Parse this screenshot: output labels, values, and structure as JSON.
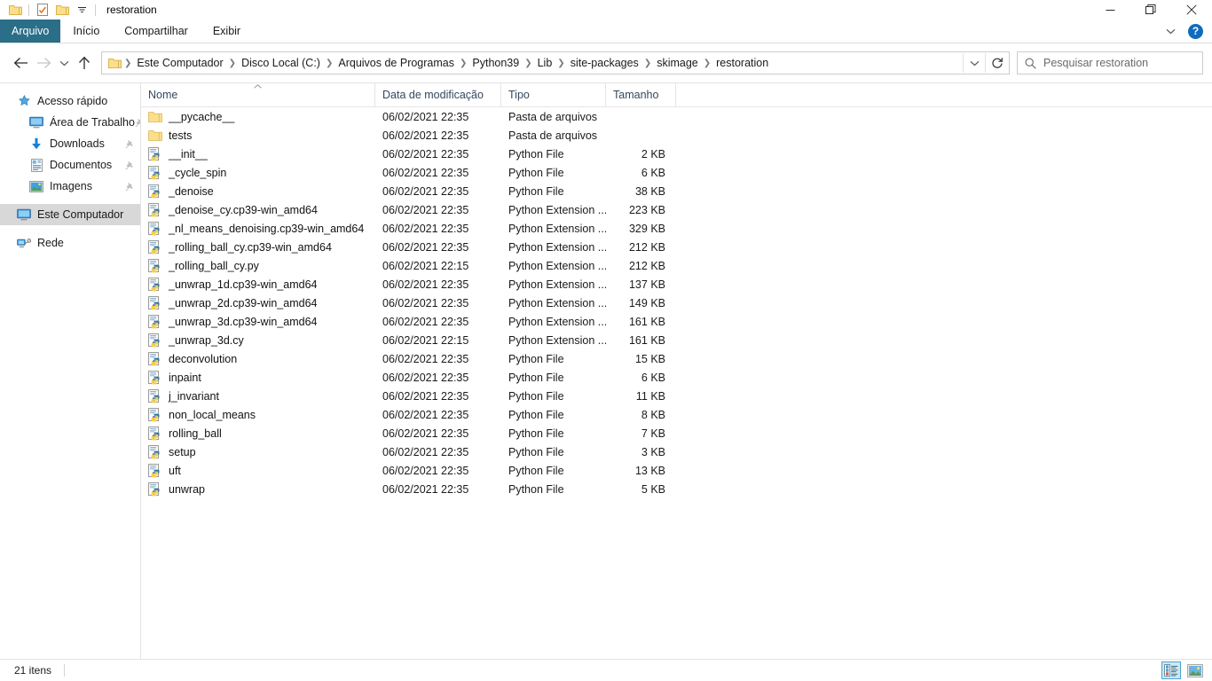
{
  "window": {
    "title": "restoration",
    "quick_access": [
      {
        "name": "folder-icon",
        "label": "Folder"
      },
      {
        "name": "properties-icon",
        "label": "Properties"
      },
      {
        "name": "new-folder-icon",
        "label": "New folder"
      },
      {
        "name": "chevron-down-icon",
        "label": "Customize Quick Access Toolbar"
      }
    ],
    "controls": {
      "minimize": "─",
      "restore": "❐",
      "close": "✕"
    }
  },
  "ribbon": {
    "tabs": [
      {
        "label": "Arquivo",
        "active": true
      },
      {
        "label": "Início",
        "active": false
      },
      {
        "label": "Compartilhar",
        "active": false
      },
      {
        "label": "Exibir",
        "active": false
      }
    ],
    "collapse_label": "ˇ",
    "help_label": "?"
  },
  "navigation": {
    "back_label": "←",
    "forward_label": "→",
    "recent_label": "ˇ",
    "up_label": "↑",
    "refresh_label": "↻",
    "address_caret_label": "ˇ"
  },
  "breadcrumb": {
    "separator": "❯",
    "items": [
      "Este Computador",
      "Disco Local (C:)",
      "Arquivos de Programas",
      "Python39",
      "Lib",
      "site-packages",
      "skimage",
      "restoration"
    ]
  },
  "search": {
    "placeholder": "Pesquisar restoration",
    "value": "",
    "icon": "search-icon"
  },
  "sidebar": {
    "items": [
      {
        "label": "Acesso rápido",
        "icon": "star-icon",
        "level": 0,
        "pinned": false,
        "selected": false
      },
      {
        "label": "Área de Trabalho",
        "icon": "desktop-icon",
        "level": 1,
        "pinned": true,
        "selected": false
      },
      {
        "label": "Downloads",
        "icon": "downloads-icon",
        "level": 1,
        "pinned": true,
        "selected": false
      },
      {
        "label": "Documentos",
        "icon": "documents-icon",
        "level": 1,
        "pinned": true,
        "selected": false
      },
      {
        "label": "Imagens",
        "icon": "pictures-icon",
        "level": 1,
        "pinned": true,
        "selected": false
      },
      {
        "label": "Este Computador",
        "icon": "this-pc-icon",
        "level": 0,
        "pinned": false,
        "selected": true
      },
      {
        "label": "Rede",
        "icon": "network-icon",
        "level": 0,
        "pinned": false,
        "selected": false
      }
    ]
  },
  "filelist": {
    "columns": [
      {
        "label": "Nome",
        "key": "name",
        "sorted": "asc"
      },
      {
        "label": "Data de modificação",
        "key": "date",
        "sorted": null
      },
      {
        "label": "Tipo",
        "key": "type",
        "sorted": null
      },
      {
        "label": "Tamanho",
        "key": "size",
        "sorted": null
      }
    ],
    "sort_indicator": "˄",
    "rows": [
      {
        "name": "__pycache__",
        "date": "06/02/2021 22:35",
        "type": "Pasta de arquivos",
        "size": "",
        "icon": "folder-icon"
      },
      {
        "name": "tests",
        "date": "06/02/2021 22:35",
        "type": "Pasta de arquivos",
        "size": "",
        "icon": "folder-icon"
      },
      {
        "name": "__init__",
        "date": "06/02/2021 22:35",
        "type": "Python File",
        "size": "2 KB",
        "icon": "python-file-icon"
      },
      {
        "name": "_cycle_spin",
        "date": "06/02/2021 22:35",
        "type": "Python File",
        "size": "6 KB",
        "icon": "python-file-icon"
      },
      {
        "name": "_denoise",
        "date": "06/02/2021 22:35",
        "type": "Python File",
        "size": "38 KB",
        "icon": "python-file-icon"
      },
      {
        "name": "_denoise_cy.cp39-win_amd64",
        "date": "06/02/2021 22:35",
        "type": "Python Extension ...",
        "size": "223 KB",
        "icon": "python-file-icon"
      },
      {
        "name": "_nl_means_denoising.cp39-win_amd64",
        "date": "06/02/2021 22:35",
        "type": "Python Extension ...",
        "size": "329 KB",
        "icon": "python-file-icon"
      },
      {
        "name": "_rolling_ball_cy.cp39-win_amd64",
        "date": "06/02/2021 22:35",
        "type": "Python Extension ...",
        "size": "212 KB",
        "icon": "python-file-icon"
      },
      {
        "name": "_rolling_ball_cy.py",
        "date": "06/02/2021 22:15",
        "type": "Python Extension ...",
        "size": "212 KB",
        "icon": "python-file-icon"
      },
      {
        "name": "_unwrap_1d.cp39-win_amd64",
        "date": "06/02/2021 22:35",
        "type": "Python Extension ...",
        "size": "137 KB",
        "icon": "python-file-icon"
      },
      {
        "name": "_unwrap_2d.cp39-win_amd64",
        "date": "06/02/2021 22:35",
        "type": "Python Extension ...",
        "size": "149 KB",
        "icon": "python-file-icon"
      },
      {
        "name": "_unwrap_3d.cp39-win_amd64",
        "date": "06/02/2021 22:35",
        "type": "Python Extension ...",
        "size": "161 KB",
        "icon": "python-file-icon"
      },
      {
        "name": "_unwrap_3d.cy",
        "date": "06/02/2021 22:15",
        "type": "Python Extension ...",
        "size": "161 KB",
        "icon": "python-file-icon"
      },
      {
        "name": "deconvolution",
        "date": "06/02/2021 22:35",
        "type": "Python File",
        "size": "15 KB",
        "icon": "python-file-icon"
      },
      {
        "name": "inpaint",
        "date": "06/02/2021 22:35",
        "type": "Python File",
        "size": "6 KB",
        "icon": "python-file-icon"
      },
      {
        "name": "j_invariant",
        "date": "06/02/2021 22:35",
        "type": "Python File",
        "size": "11 KB",
        "icon": "python-file-icon"
      },
      {
        "name": "non_local_means",
        "date": "06/02/2021 22:35",
        "type": "Python File",
        "size": "8 KB",
        "icon": "python-file-icon"
      },
      {
        "name": "rolling_ball",
        "date": "06/02/2021 22:35",
        "type": "Python File",
        "size": "7 KB",
        "icon": "python-file-icon"
      },
      {
        "name": "setup",
        "date": "06/02/2021 22:35",
        "type": "Python File",
        "size": "3 KB",
        "icon": "python-file-icon"
      },
      {
        "name": "uft",
        "date": "06/02/2021 22:35",
        "type": "Python File",
        "size": "13 KB",
        "icon": "python-file-icon"
      },
      {
        "name": "unwrap",
        "date": "06/02/2021 22:35",
        "type": "Python File",
        "size": "5 KB",
        "icon": "python-file-icon"
      }
    ]
  },
  "statusbar": {
    "item_count": "21 itens",
    "views": [
      {
        "name": "details-view-button",
        "active": true
      },
      {
        "name": "large-icons-view-button",
        "active": false
      }
    ]
  },
  "colors": {
    "file_tab": "#2b6e88",
    "selection": "#d8d8d8",
    "help_button": "#0f6cbd",
    "view_active": "#cce8f4",
    "folder": "#fcdf8a",
    "header_text": "#34495e"
  }
}
